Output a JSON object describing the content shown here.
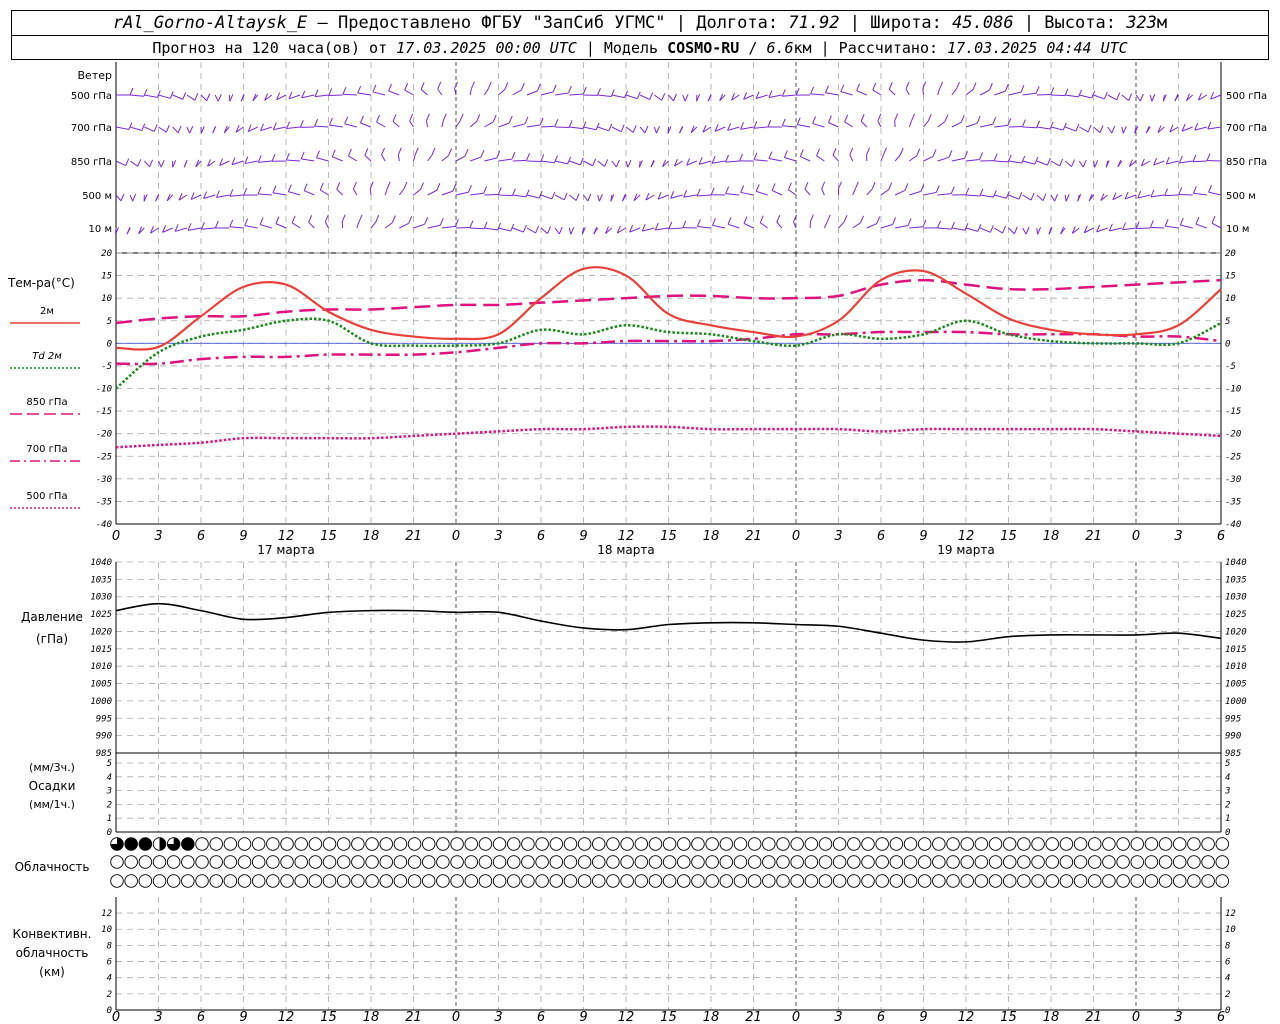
{
  "header": {
    "station": "rAl_Gorno-Altaysk_E",
    "provided_prefix": " – Предоставлено ФГБУ \"ЗапСиб УГМС\" | Долгота:",
    "longitude": "71.92",
    "lat_label": " | Широта:",
    "latitude": "45.086",
    "alt_label": " | Высота:",
    "altitude": "323",
    "alt_unit": "м",
    "forecast_prefix": "Прогноз на 120 часа(ов) от",
    "forecast_start": "17.03.2025 00:00 UTC",
    "model_label": "| Модель",
    "model": "COSMO-RU",
    "resolution": "6.6",
    "res_unit": "км",
    "computed_label": "| Рассчитано:",
    "computed": "17.03.2025 04:44 UTC"
  },
  "time_axis": {
    "hour_ticks": [
      "0",
      "3",
      "6",
      "9",
      "12",
      "15",
      "18",
      "21",
      "0",
      "3",
      "6",
      "9",
      "12",
      "15",
      "18",
      "21",
      "0",
      "3",
      "6",
      "9",
      "12",
      "15",
      "18",
      "21",
      "0",
      "3",
      "6"
    ],
    "day_labels": [
      "17 марта",
      "18 марта",
      "19 марта"
    ]
  },
  "wind_panel": {
    "title": "Ветер",
    "levels": [
      "500 гПа",
      "700 гПа",
      "850 гПа",
      "500 м",
      "10 м"
    ],
    "color": "#7a28d6"
  },
  "temp_panel": {
    "title": "Тем-ра(°С)",
    "legend": [
      "2м",
      "Td 2м",
      "850 гПа",
      "700 гПа",
      "500 гПа"
    ],
    "yticks": [
      "20",
      "15",
      "10",
      "5",
      "0",
      "-5",
      "-10",
      "-15",
      "-20",
      "-25",
      "-30",
      "-35",
      "-40"
    ]
  },
  "pressure_panel": {
    "title": "Давление",
    "unit": "(гПа)",
    "yticks": [
      "1040",
      "1035",
      "1030",
      "1025",
      "1020",
      "1015",
      "1010",
      "1005",
      "1000",
      "995",
      "990",
      "985"
    ]
  },
  "precip_panel": {
    "unit_top": "(мм/3ч.)",
    "title": "Осадки",
    "unit_bottom": "(мм/1ч.)",
    "yticks": [
      "5",
      "4",
      "3",
      "2",
      "1",
      "0"
    ]
  },
  "cloud_panel": {
    "title": "Облачность",
    "top_row_fill": [
      0.75,
      1,
      1,
      0.5,
      0.75,
      1,
      0,
      0,
      0,
      0,
      0,
      0,
      0,
      0,
      0,
      0,
      0,
      0,
      0,
      0,
      0,
      0,
      0,
      0,
      0,
      0,
      0,
      0,
      0,
      0,
      0,
      0,
      0,
      0,
      0,
      0,
      0,
      0,
      0,
      0,
      0,
      0,
      0,
      0,
      0,
      0,
      0,
      0,
      0,
      0,
      0,
      0,
      0,
      0,
      0,
      0,
      0,
      0,
      0,
      0,
      0,
      0,
      0,
      0,
      0,
      0,
      0,
      0,
      0,
      0,
      0,
      0,
      0,
      0,
      0,
      0,
      0,
      0,
      0
    ]
  },
  "conv_panel": {
    "title_lines": [
      "Конвективн.",
      "облачность",
      "(км)"
    ],
    "yticks": [
      "12",
      "10",
      "8",
      "6",
      "4",
      "2",
      "0"
    ]
  },
  "chart_data": [
    {
      "type": "line",
      "title": "Тем-ра(°С)",
      "ylim": [
        -40,
        20
      ],
      "x_hours": [
        0,
        3,
        6,
        9,
        12,
        15,
        18,
        21,
        24,
        27,
        30,
        33,
        36,
        39,
        42,
        45,
        48,
        51,
        54,
        57,
        60,
        63,
        66,
        69,
        72,
        75,
        78
      ],
      "series": [
        {
          "name": "2м",
          "color": "#e8413a",
          "style": "solid",
          "values": [
            -1,
            -0.8,
            6,
            12.5,
            13,
            7,
            3,
            1.5,
            1,
            2,
            10,
            16.5,
            15,
            6.5,
            4,
            2.5,
            1.5,
            5,
            14,
            16,
            11,
            5.5,
            3,
            2,
            2,
            4,
            12
          ]
        },
        {
          "name": "Td 2м",
          "color": "#1b8a1b",
          "style": "dotted",
          "values": [
            -10,
            -2,
            1.5,
            3,
            5,
            5,
            0,
            -0.5,
            -0.5,
            0,
            3,
            2,
            4,
            2.5,
            2,
            0.5,
            -0.5,
            2,
            1,
            2,
            5,
            2,
            0.5,
            0,
            0,
            0,
            4.5
          ]
        },
        {
          "name": "850 гПа",
          "color": "#e0127f",
          "style": "longdash",
          "values": [
            4.5,
            5.5,
            6,
            6,
            7,
            7.5,
            7.5,
            8,
            8.5,
            8.5,
            9,
            9.5,
            10,
            10.5,
            10.5,
            10,
            10,
            10.5,
            13,
            14,
            13,
            12,
            12,
            12.5,
            13,
            13.5,
            14
          ]
        },
        {
          "name": "700 гПа",
          "color": "#e0127f",
          "style": "dashdot",
          "values": [
            -4.5,
            -4.5,
            -3.5,
            -3,
            -3,
            -2.5,
            -2.5,
            -2.5,
            -2,
            -1,
            0,
            0,
            0.5,
            0.5,
            0.5,
            1,
            2,
            2,
            2.5,
            2.5,
            2.5,
            2,
            2,
            2,
            1.5,
            1.5,
            0.5
          ]
        },
        {
          "name": "500 гПа",
          "color": "#e0127f",
          "style": "dotted",
          "values": [
            -23,
            -22.5,
            -22,
            -21,
            -21,
            -21,
            -21,
            -20.5,
            -20,
            -19.5,
            -19,
            -19,
            -18.5,
            -18.5,
            -19,
            -19,
            -19,
            -19,
            -19.5,
            -19,
            -19,
            -19,
            -19,
            -19,
            -19.5,
            -20,
            -20.5
          ]
        }
      ]
    },
    {
      "type": "line",
      "title": "Давление",
      "ylim": [
        985,
        1040
      ],
      "x_hours": [
        0,
        3,
        6,
        9,
        12,
        15,
        18,
        21,
        24,
        27,
        30,
        33,
        36,
        39,
        42,
        45,
        48,
        51,
        54,
        57,
        60,
        63,
        66,
        69,
        72,
        75,
        78
      ],
      "series": [
        {
          "color": "#000000",
          "style": "solid",
          "values": [
            1026,
            1028,
            1026,
            1023.5,
            1024,
            1025.5,
            1026,
            1026,
            1025.5,
            1025.5,
            1023,
            1021,
            1020.5,
            1022,
            1022.5,
            1022.5,
            1022,
            1021.5,
            1019.5,
            1017.5,
            1017,
            1018.5,
            1019,
            1019,
            1019,
            1019.5,
            1018
          ]
        }
      ]
    },
    {
      "type": "bar",
      "title": "Осадки",
      "ylim": [
        0,
        5
      ],
      "x_hours": [],
      "values": []
    }
  ]
}
